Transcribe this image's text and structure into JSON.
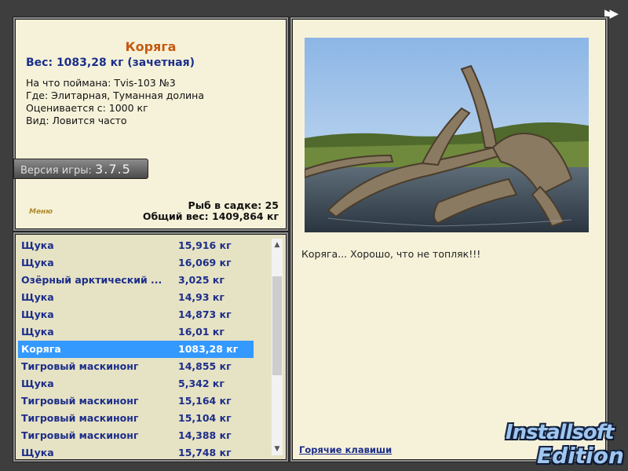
{
  "fish": {
    "name": "Коряга",
    "weight_line": "Вес: 1083,28 кг (зачетная)",
    "caught_on": "На что поймана: Tvis-103 №3",
    "where": "Где: Элитарная, Туманная долина",
    "rated_from": "Оценивается с: 1000 кг",
    "kind": "Вид: Ловится часто"
  },
  "version": {
    "label": "Версия игры:",
    "value": "3.7.5"
  },
  "keepnet": {
    "count_line": "Рыб в садке: 25",
    "total_line": "Общий вес: 1409,864 кг"
  },
  "menu_label": "Меню",
  "catch_list": [
    {
      "name": "Щука",
      "weight": "15,916 кг"
    },
    {
      "name": "Щука",
      "weight": "16,069 кг"
    },
    {
      "name": "Озёрный арктический ...",
      "weight": "3,025 кг"
    },
    {
      "name": "Щука",
      "weight": "14,93 кг"
    },
    {
      "name": "Щука",
      "weight": "14,873 кг"
    },
    {
      "name": "Щука",
      "weight": "16,01 кг"
    },
    {
      "name": "Коряга",
      "weight": "1083,28 кг"
    },
    {
      "name": "Тигровый маскинонг",
      "weight": "14,855 кг"
    },
    {
      "name": "Щука",
      "weight": "5,342 кг"
    },
    {
      "name": "Тигровый маскинонг",
      "weight": "15,164 кг"
    },
    {
      "name": "Тигровый маскинонг",
      "weight": "15,104 кг"
    },
    {
      "name": "Тигровый маскинонг",
      "weight": "14,388 кг"
    },
    {
      "name": "Щука",
      "weight": "15,748 кг"
    }
  ],
  "selected_index": 6,
  "caption": "Коряга... Хорошо, что не топляк!!!",
  "hotkeys_link": "Горячие клавиши",
  "logo": {
    "line1": "Installsoft",
    "line2": "Edition"
  },
  "colors": {
    "selection": "#3399ff",
    "title": "#c45a12",
    "accent": "#1c2e8a"
  }
}
